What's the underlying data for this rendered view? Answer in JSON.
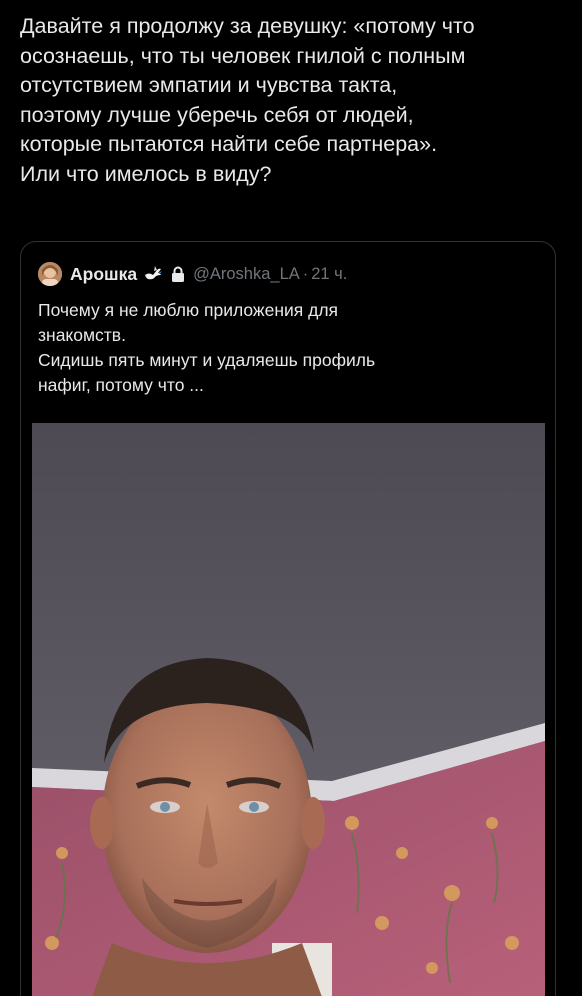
{
  "tweet": {
    "text": "Давайте я продолжу за девушку: «потому что\nосознаешь, что ты человек гнилой с полным\nотсутствием эмпатии и чувства такта,\nпоэтому лучше уберечь себя от людей,\nкоторые пытаются найти себе партнера».\nИли что имелось в виду?"
  },
  "quote": {
    "name": "Арошка",
    "emoji_icon": "dove-icon",
    "lock_icon": "lock-icon",
    "handle": "@Aroshka_LA",
    "separator": "·",
    "time": "21 ч.",
    "text": "Почему я не люблю приложения для\nзнакомств.\nСидишь пять минут и удаляешь профиль\nнафиг, потому что ...",
    "media": {
      "kind": "selfie photo of a man in a room with pink floral wallpaper"
    }
  },
  "colors": {
    "background": "#000000",
    "text_primary": "#e7e9ea",
    "text_secondary": "#71767b",
    "border": "#2f3336"
  }
}
